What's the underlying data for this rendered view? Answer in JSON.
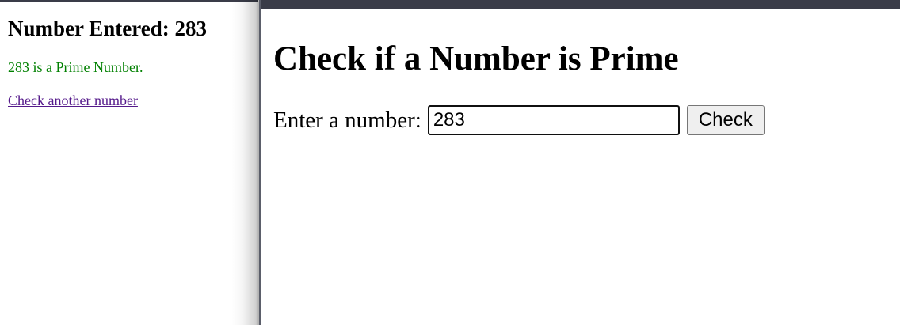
{
  "result_page": {
    "title": "Number Entered: 283",
    "message": "283 is a Prime Number.",
    "back_link": "Check another number"
  },
  "form_page": {
    "title": "Check if a Number is Prime",
    "label": "Enter a number:",
    "input_value": "283",
    "button_label": "Check"
  },
  "colors": {
    "prime_message": "#008000",
    "visited_link": "#551a8b",
    "window_chrome": "#3a3c48"
  }
}
